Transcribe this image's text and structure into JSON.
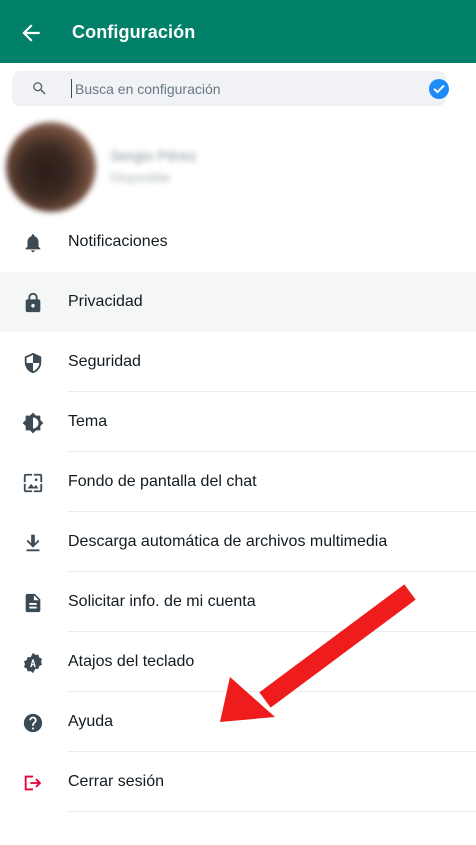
{
  "header": {
    "title": "Configuración"
  },
  "search": {
    "placeholder": "Busca en configuración",
    "value": ""
  },
  "profile": {
    "name": "Sergio Pérez",
    "about": "Disponible"
  },
  "menu": {
    "items": [
      {
        "label": "Notificaciones",
        "icon": "bell-icon"
      },
      {
        "label": "Privacidad",
        "icon": "lock-icon",
        "selected": true
      },
      {
        "label": "Seguridad",
        "icon": "shield-icon"
      },
      {
        "label": "Tema",
        "icon": "theme-icon"
      },
      {
        "label": "Fondo de pantalla del chat",
        "icon": "wallpaper-icon"
      },
      {
        "label": "Descarga automática de archivos multimedia",
        "icon": "download-icon"
      },
      {
        "label": "Solicitar info. de mi cuenta",
        "icon": "document-icon"
      },
      {
        "label": "Atajos del teclado",
        "icon": "keyboard-shortcut-icon"
      },
      {
        "label": "Ayuda",
        "icon": "help-icon"
      },
      {
        "label": "Cerrar sesión",
        "icon": "logout-icon"
      }
    ]
  },
  "colors": {
    "header": "#008069",
    "accent_check": "#1d8cf8",
    "icon": "#3b4a54",
    "logout_icon": "#ea0038",
    "annotation_arrow": "#ee1c1c"
  }
}
